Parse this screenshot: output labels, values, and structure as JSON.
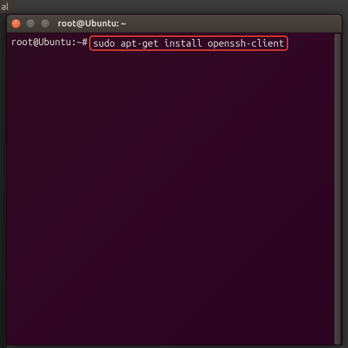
{
  "partial_tab_text": "al",
  "window": {
    "title": "root@Ubuntu: ~"
  },
  "terminal": {
    "prompt": "root@Ubuntu:~#",
    "command": "sudo apt-get install openssh-client"
  }
}
